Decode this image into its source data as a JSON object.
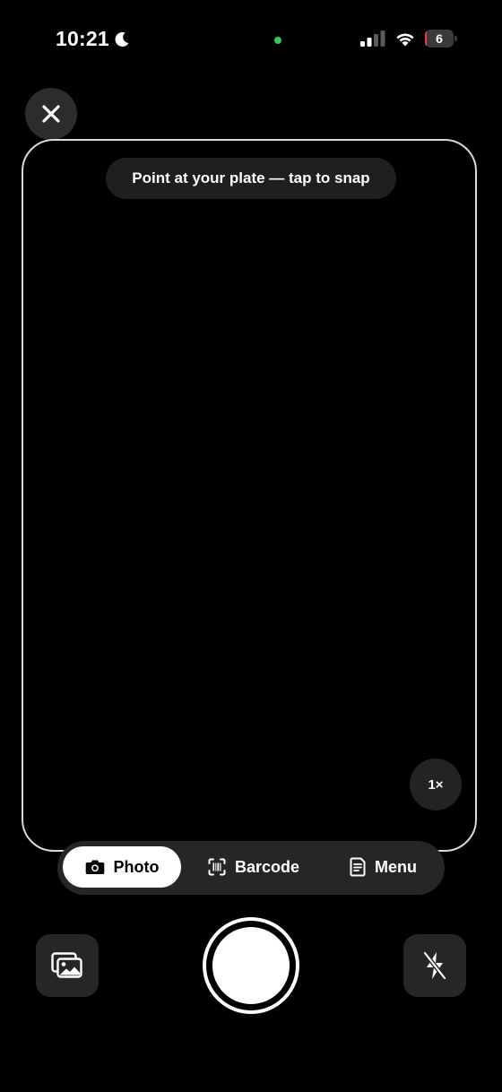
{
  "status_bar": {
    "time": "10:21",
    "battery_level": "6",
    "battery_fraction": 0.06,
    "focus_icon": "moon-icon",
    "signal_icon": "cellular-signal-icon",
    "wifi_icon": "wifi-icon",
    "privacy_indicator_color": "#34c759"
  },
  "camera": {
    "close_icon": "close-icon",
    "hint": "Point at your plate — tap to snap",
    "zoom": "1×"
  },
  "modes": [
    {
      "label": "Photo",
      "icon": "camera-icon",
      "selected": true
    },
    {
      "label": "Barcode",
      "icon": "barcode-scan-icon",
      "selected": false
    },
    {
      "label": "Menu",
      "icon": "menu-document-icon",
      "selected": false
    }
  ],
  "controls": {
    "gallery_icon": "photo-gallery-icon",
    "shutter_icon": "shutter-button",
    "flash_icon": "flash-off-icon"
  }
}
